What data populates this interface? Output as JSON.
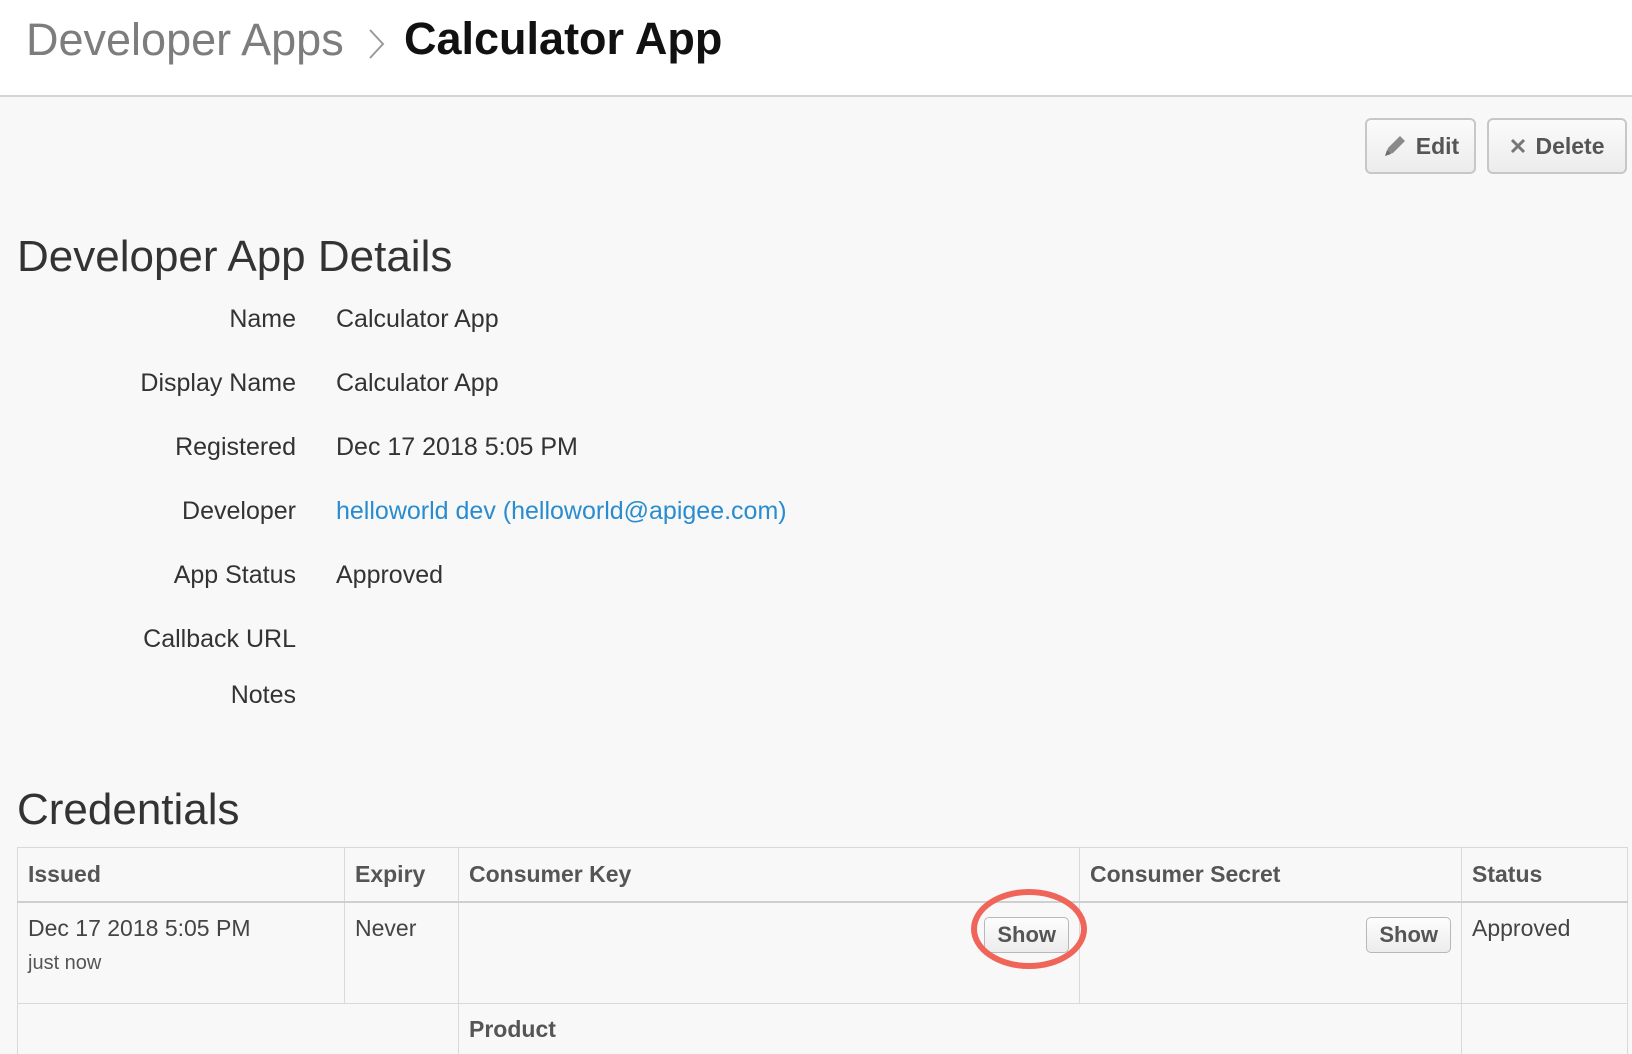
{
  "breadcrumb": {
    "root": "Developer Apps",
    "current": "Calculator App"
  },
  "actions": {
    "edit_label": "Edit",
    "delete_label": "Delete"
  },
  "details": {
    "title": "Developer App Details",
    "rows": [
      {
        "label": "Name",
        "value": "Calculator App"
      },
      {
        "label": "Display Name",
        "value": "Calculator App"
      },
      {
        "label": "Registered",
        "value": "Dec 17 2018 5:05 PM"
      },
      {
        "label": "Developer",
        "value": "helloworld dev (helloworld@apigee.com)"
      },
      {
        "label": "App Status",
        "value": "Approved"
      },
      {
        "label": "Callback URL",
        "value": ""
      },
      {
        "label": "Notes",
        "value": ""
      }
    ]
  },
  "credentials": {
    "title": "Credentials",
    "headers": [
      "Issued",
      "Expiry",
      "Consumer Key",
      "Consumer Secret",
      "Status"
    ],
    "rows": [
      {
        "issued": "Dec 17 2018 5:05 PM",
        "issued_relative": "just now",
        "expiry": "Never",
        "consumer_key_button": "Show",
        "consumer_secret_button": "Show",
        "status": "Approved"
      }
    ],
    "product_header": "Product"
  },
  "colors": {
    "link": "#2a8ccf",
    "highlight": "#f0655a",
    "background": "#f7f8f7"
  },
  "icons": {
    "edit": "pencil-icon",
    "delete": "close-icon",
    "separator": "chevron-right-icon"
  }
}
